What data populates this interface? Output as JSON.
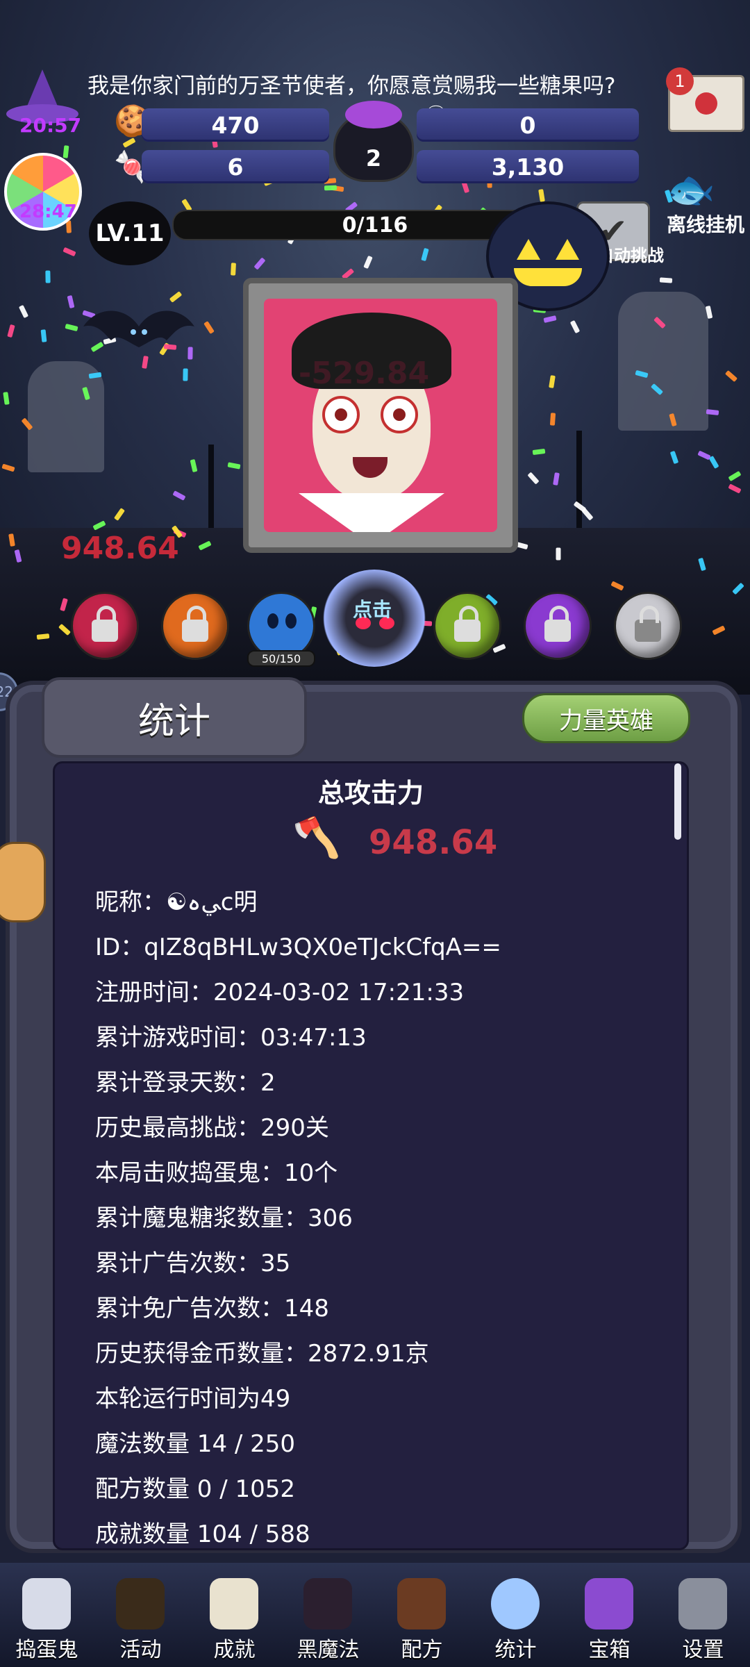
{
  "header": {
    "message": "我是你家门前的万圣节使者，你愿意赏赐我一些糖果吗?",
    "mail_badge": "1",
    "timer_hat": "20:57",
    "timer_candy": "28:47"
  },
  "resources": {
    "cookies": "470",
    "skull_potion": "0",
    "candy_bag": "6",
    "cauldron": "2",
    "candy_corn": "3,130"
  },
  "level": {
    "label": "LV.11",
    "progress_text": "0/116",
    "auto_label": "自动挑战",
    "offline_label": "离线挂机"
  },
  "battle": {
    "damage_float": "-529.84",
    "damage_total": "948.64",
    "orb_capacity": "50/150",
    "tap_label": "点击",
    "side_bubble": "22"
  },
  "panel": {
    "title": "统计",
    "hero_button": "力量英雄",
    "stat_title": "总攻击力",
    "stat_value": "948.64",
    "lines": [
      "昵称：☯ﻲہc明",
      "ID：qIZ8qBHLw3QX0eTJckCfqA==",
      "注册时间：2024-03-02 17:21:33",
      "累计游戏时间：03:47:13",
      "累计登录天数：2",
      "历史最高挑战：290关",
      "本局击败捣蛋鬼：10个",
      "累计魔鬼糖浆数量：306",
      "累计广告次数：35",
      "累计免广告次数：148",
      "历史获得金币数量：2872.91京",
      "本轮运行时间为49",
      "魔法数量 14 / 250",
      "配方数量 0 / 1052",
      "成就数量 104 / 588"
    ]
  },
  "nav": {
    "items": [
      {
        "label": "捣蛋鬼",
        "icon": "ghost-icon"
      },
      {
        "label": "活动",
        "icon": "candy-bowl-icon"
      },
      {
        "label": "成就",
        "icon": "skull-icon"
      },
      {
        "label": "黑魔法",
        "icon": "demon-icon"
      },
      {
        "label": "配方",
        "icon": "book-icon"
      },
      {
        "label": "统计",
        "icon": "crystal-ball-icon"
      },
      {
        "label": "宝箱",
        "icon": "treasure-chest-icon"
      },
      {
        "label": "设置",
        "icon": "gear-icon"
      }
    ]
  },
  "colors": {
    "damage_red": "#c83a4a",
    "accent_green": "#8bbf5a",
    "panel_bg": "#23203f",
    "level_purple": "#c23bff"
  }
}
